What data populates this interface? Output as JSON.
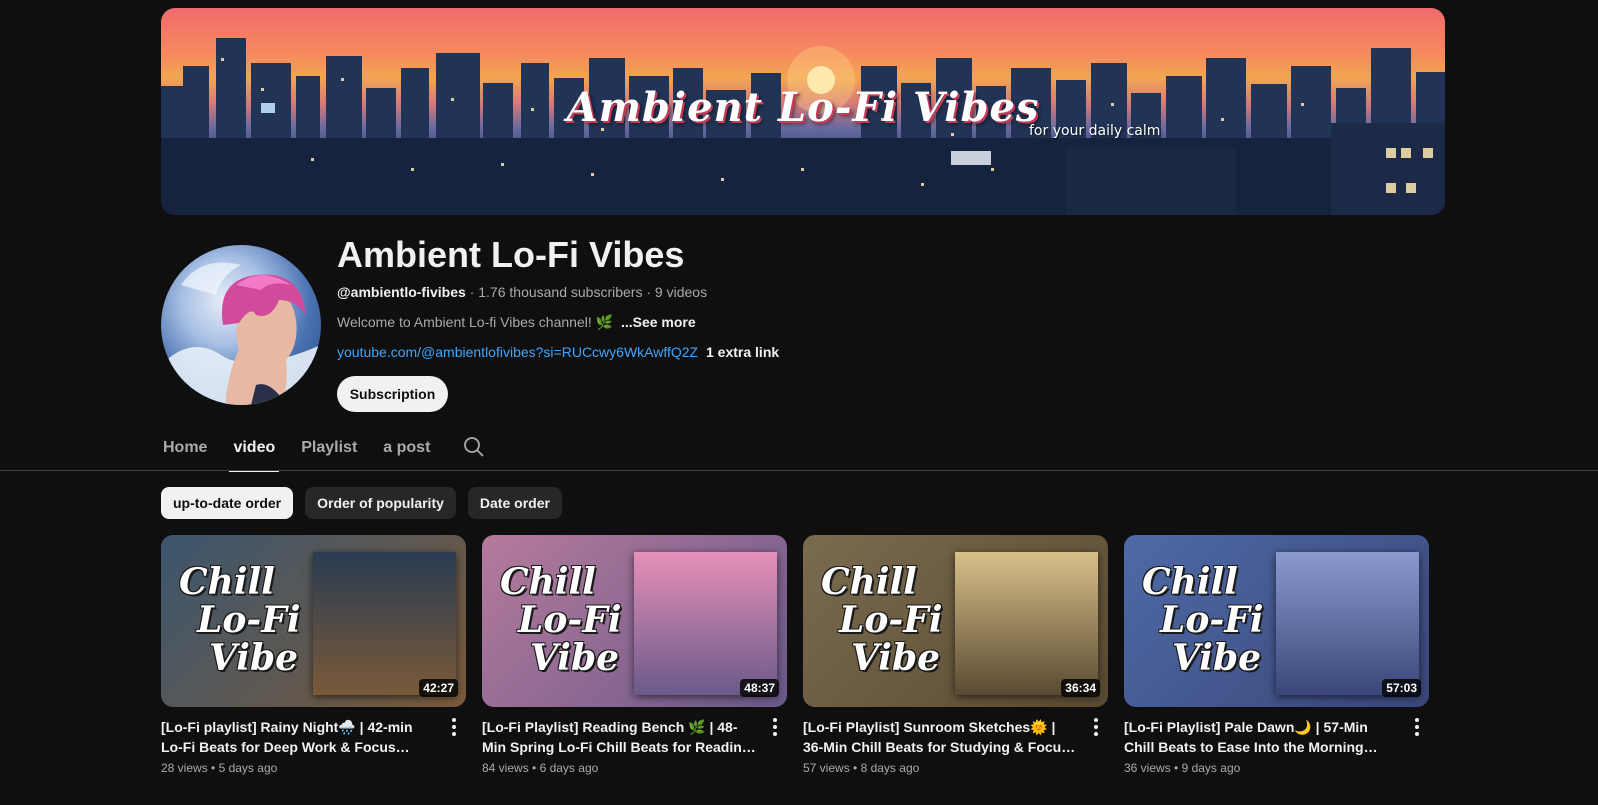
{
  "banner": {
    "title": "Ambient Lo-Fi Vibes",
    "subtitle": "for your daily calm"
  },
  "channel": {
    "name": "Ambient Lo-Fi Vibes",
    "handle": "@ambientlo-fivibes",
    "subscribers": "1.76 thousand subscribers",
    "videos": "9 videos",
    "description": "Welcome to Ambient Lo-fi Vibes channel! 🌿",
    "see_more": "...See more",
    "link": "youtube.com/@ambientlofivibes?si=RUCcwy6WkAwffQ2Z",
    "extra_link": "1 extra link",
    "subscribe_label": "Subscription"
  },
  "tabs": [
    {
      "label": "Home",
      "active": false
    },
    {
      "label": "video",
      "active": true
    },
    {
      "label": "Playlist",
      "active": false
    },
    {
      "label": "a post",
      "active": false
    }
  ],
  "chips": [
    {
      "label": "up-to-date order",
      "active": true
    },
    {
      "label": "Order of popularity",
      "active": false
    },
    {
      "label": "Date order",
      "active": false
    }
  ],
  "thumbnail_text": {
    "line1": "Chill",
    "line2": "Lo-Fi",
    "line3": "Vibe"
  },
  "videos": [
    {
      "title": "[Lo-Fi playlist] Rainy Night🌧️ | 42-min Lo-Fi Beats for Deep Work & Focus #chilllofivibe",
      "duration": "42:27",
      "views": "28 views",
      "age": "5 days ago",
      "bg": "#3c566e",
      "art_top": "#2a3c52",
      "art_bottom": "#7a5a3a"
    },
    {
      "title": "[Lo-Fi Playlist] Reading Bench 🌿 | 48-Min Spring Lo-Fi Chill Beats for Reading & Relaxation",
      "duration": "48:37",
      "views": "84 views",
      "age": "6 days ago",
      "bg": "#b57a9c",
      "art_top": "#e690b8",
      "art_bottom": "#6a5a8a"
    },
    {
      "title": "[Lo-Fi Playlist] Sunroom Sketches🌞 | 36-Min Chill Beats for Studying & Focus #chilllofivibe",
      "duration": "36:34",
      "views": "57 views",
      "age": "8 days ago",
      "bg": "#7a6a4e",
      "art_top": "#d8c08a",
      "art_bottom": "#5a4a32"
    },
    {
      "title": "[Lo-Fi Playlist] Pale Dawn🌙 | 57-Min Chill Beats to Ease Into the Morning #chilllofivibe",
      "duration": "57:03",
      "views": "36 views",
      "age": "9 days ago",
      "bg": "#4e6aa6",
      "art_top": "#8a9ad0",
      "art_bottom": "#3a4678"
    }
  ]
}
